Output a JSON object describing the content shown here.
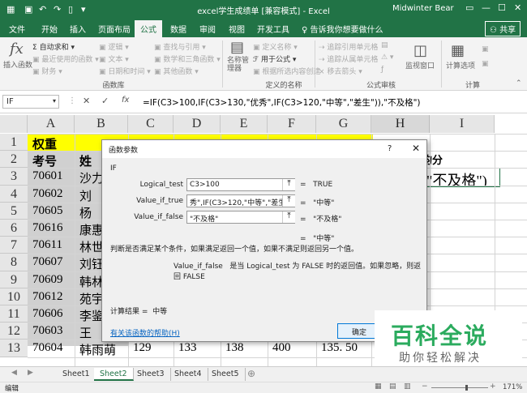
{
  "window": {
    "title": "excel学生成绩单 [兼容模式] - Excel",
    "user": "Midwinter Bear",
    "tell_me": "告诉我你想要做什么",
    "share": "共享"
  },
  "tabs": [
    "文件",
    "开始",
    "插入",
    "页面布局",
    "公式",
    "数据",
    "审阅",
    "视图",
    "开发工具"
  ],
  "active_tab": "公式",
  "ribbon": {
    "insert_function": "插入函数",
    "autosum": "自动求和",
    "recent": "最近使用的函数",
    "financial": "财务",
    "logical": "逻辑",
    "text": "文本",
    "datetime": "日期和时间",
    "lookup": "查找与引用",
    "math": "数学和三角函数",
    "other": "其他函数",
    "group_library": "函数库",
    "name_manager": "名称管理器",
    "define_name": "定义名称",
    "use_in_formula": "用于公式",
    "create_from_selection": "根据所选内容创建",
    "group_names": "定义的名称",
    "trace_precedents": "追踪引用单元格",
    "trace_dependents": "追踪从属单元格",
    "remove_arrows": "移去箭头",
    "group_audit": "公式审核",
    "watch_window": "监视窗口",
    "calc_options": "计算选项",
    "group_calc": "计算"
  },
  "formula_bar": {
    "name_box": "IF",
    "formula": "=IF(C3>100,IF(C3>130,\"优秀\",IF(C3>120,\"中等\",\"差生\")),\"不及格\")"
  },
  "columns": [
    "A",
    "B",
    "C",
    "D",
    "E",
    "F",
    "G",
    "H",
    "I"
  ],
  "rows": [
    "1",
    "2",
    "3",
    "4",
    "5",
    "6",
    "7",
    "8",
    "9",
    "10",
    "11",
    "12",
    "13"
  ],
  "cells": {
    "a1": "权重",
    "a2": "考号",
    "b2": "姓",
    "a3": "70601",
    "b3": "沙力",
    "a4": "70602",
    "b4": "刘",
    "a5": "70605",
    "b5": "杨",
    "a6": "70616",
    "b6": "康惠",
    "a7": "70611",
    "b7": "林世",
    "a8": "70607",
    "b8": "刘钰",
    "a9": "70609",
    "b9": "韩林",
    "a10": "70612",
    "b10": "苑宇",
    "a11": "70606",
    "b11": "李鉴",
    "a12": "70603",
    "b12": "王",
    "a13": "70604",
    "b13": "韩雨萌",
    "c13": "129",
    "d13": "133",
    "e13": "138",
    "f13": "400",
    "g13": "135. 50",
    "h2": "平均分",
    "i3": "\"不及格\")"
  },
  "dialog": {
    "title": "函数参数",
    "function_name": "IF",
    "args": [
      {
        "label": "Logical_test",
        "value": "C3>100",
        "result": "TRUE"
      },
      {
        "label": "Value_if_true",
        "value": "秀\",IF(C3>120,\"中等\",\"差生\"))",
        "result": "\"中等\""
      },
      {
        "label": "Value_if_false",
        "value": "\"不及格\"",
        "result": "\"不及格\""
      }
    ],
    "overall_result": "\"中等\"",
    "description": "判断是否满足某个条件，如果满足返回一个值，如果不满足则返回另一个值。",
    "arg_name": "Value_if_false",
    "arg_desc": "是当 Logical_test 为 FALSE 时的返回值。如果忽略，则返回 FALSE",
    "calc_label": "计算结果 =",
    "calc_value": "中等",
    "help_link": "有关该函数的帮助(H)",
    "ok": "确定",
    "help_btn": "?",
    "close": "✕",
    "eq": "="
  },
  "sheets": [
    "Sheet1",
    "Sheet2",
    "Sheet3",
    "Sheet4",
    "Sheet5"
  ],
  "active_sheet": "Sheet2",
  "status": {
    "mode": "编辑",
    "zoom": "171%"
  },
  "watermark": {
    "main": "百科全说",
    "sub": "助你轻松解决"
  },
  "colors": {
    "excel_green": "#217346",
    "highlight": "#ffff00",
    "watermark": "#2bab5e"
  }
}
